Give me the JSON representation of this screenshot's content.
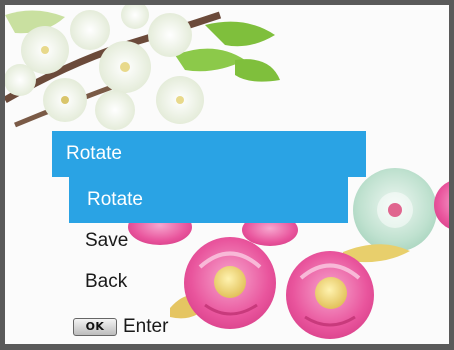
{
  "menu": {
    "title": "Rotate",
    "items": [
      {
        "label": "Rotate",
        "selected": true
      },
      {
        "label": "Save",
        "selected": false
      },
      {
        "label": "Back",
        "selected": false
      }
    ]
  },
  "footer": {
    "key_label": "OK",
    "action_label": "Enter"
  },
  "colors": {
    "highlight": "#2aa3e4",
    "frame": "#5a5a5a"
  },
  "icons": [
    "ok-button-icon"
  ]
}
